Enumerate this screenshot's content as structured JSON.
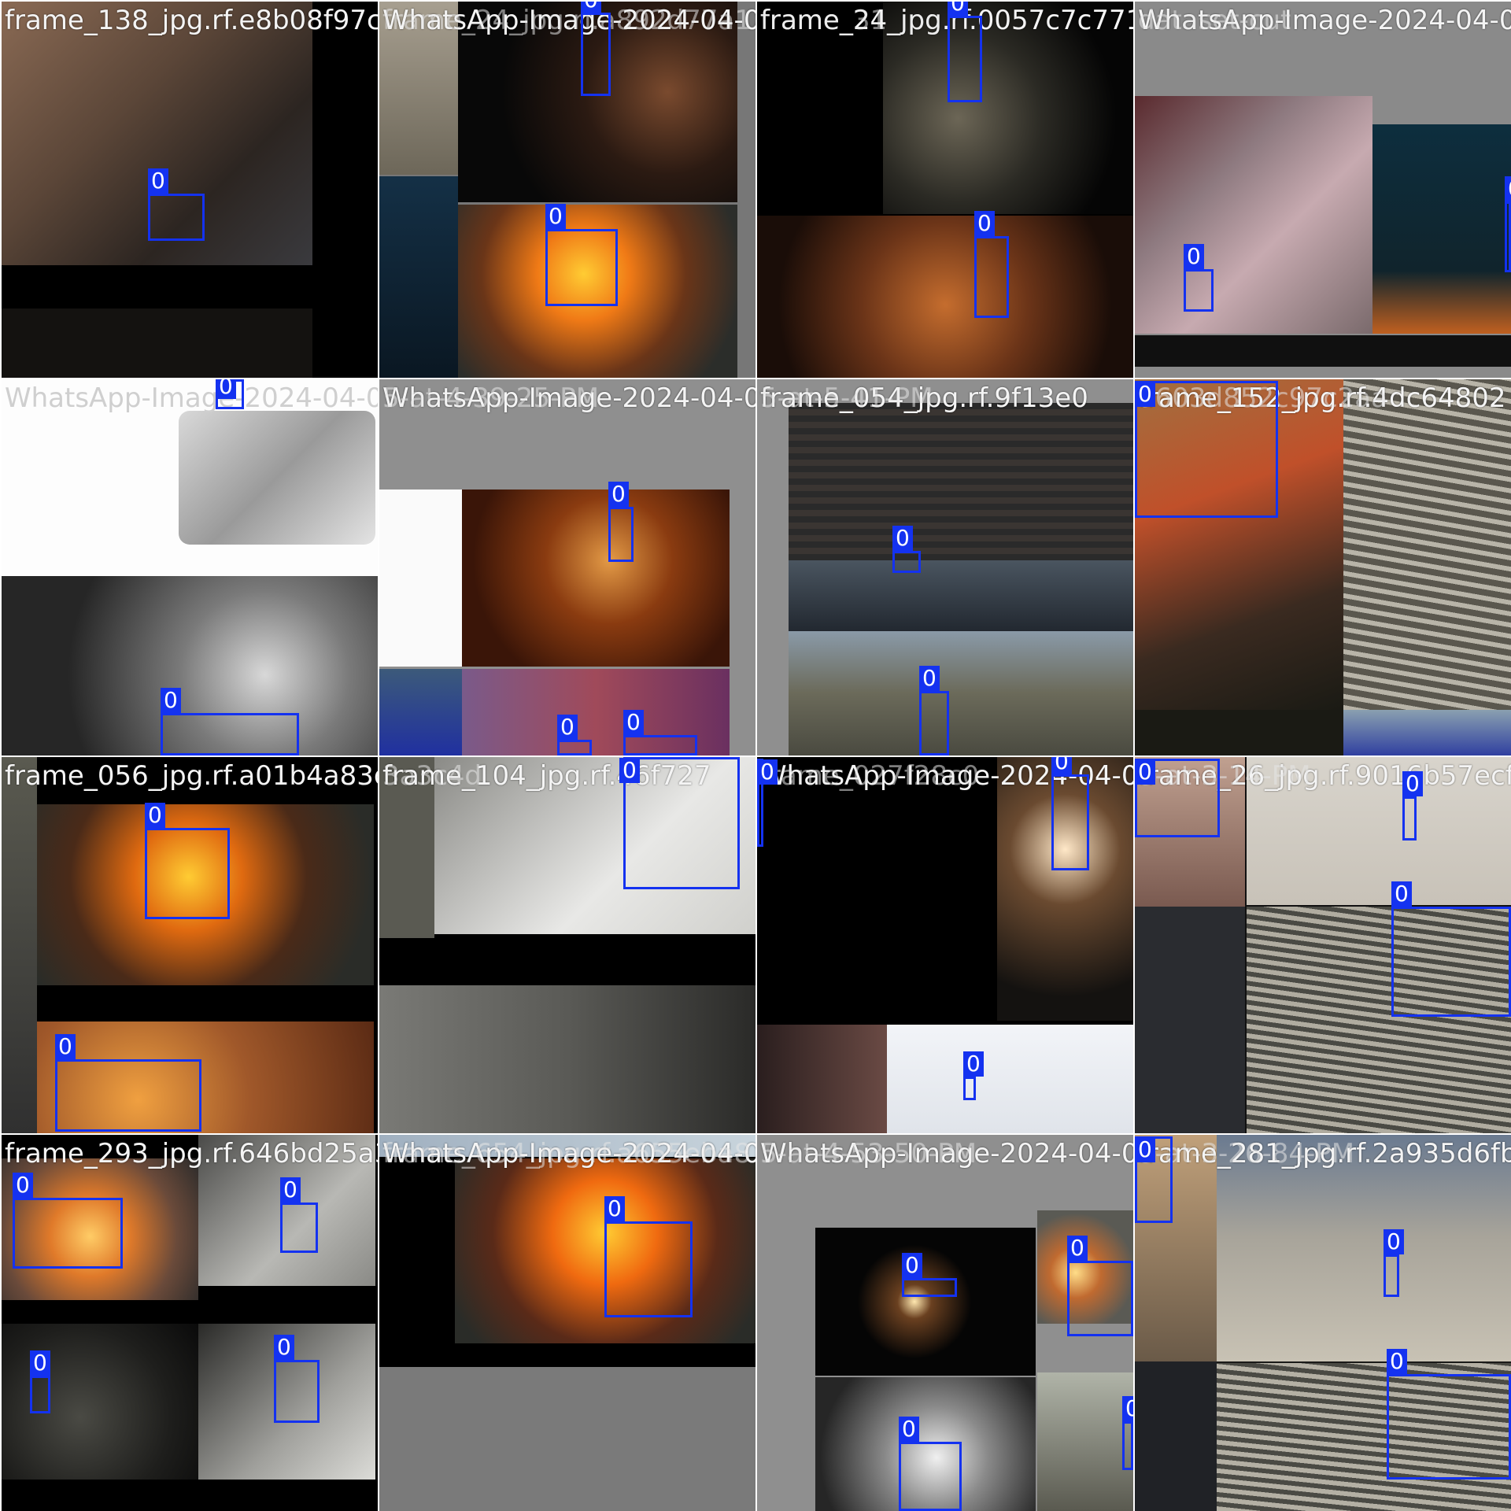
{
  "grid_label": "fire-detection-mosaic",
  "colors": {
    "box": "#1432f0",
    "label_text": "#ffffff",
    "title_text": "#f4f4f4"
  },
  "box_label": "0",
  "tiles": [
    {
      "title": "frame_138_jpg.rf.e8b08f97c",
      "overlay": "",
      "boxes": [
        "0"
      ]
    },
    {
      "title": "WhatsApp-Image-2024-04-0",
      "overlay": "frame_24_jpg.rf.a892d77a1",
      "boxes": [
        "0",
        "0"
      ]
    },
    {
      "title": "frame_24_jpg.rf.0057c7c771",
      "overlay": "frame_31_jpg",
      "boxes": [
        "0",
        "0"
      ]
    },
    {
      "title": "WhatsApp-Image-2024-04-0",
      "overlay": "dataset-cut",
      "boxes": [
        "0",
        "0"
      ]
    },
    {
      "title": "WhatsApp-Image-2024-04-0",
      "overlay": "",
      "boxes": [
        "0",
        "0"
      ]
    },
    {
      "title": "WhatsApp-Image-2024-04-0",
      "overlay": "5-at-4-39-25-PM",
      "boxes": [
        "0",
        "0",
        "0"
      ]
    },
    {
      "title": "frame_054_jpg.rf.9f13e0",
      "overlay": "5-at-5-41-PM",
      "boxes": [
        "0",
        "0"
      ]
    },
    {
      "title": "frame_152_jpg.rf.4dc64802",
      "overlay": "9603d852c97c2aa",
      "boxes": [
        "0"
      ]
    },
    {
      "title": "frame_056_jpg.rf.a01b4a83d",
      "overlay": "",
      "boxes": [
        "0",
        "0"
      ]
    },
    {
      "title": "frame_104_jpg.rf.46f727",
      "overlay": "3a3c4d",
      "boxes": [
        "0"
      ]
    },
    {
      "title": "WhatsApp-Image-2024-04-0",
      "overlay": "frame_027f28c0",
      "boxes": [
        "0",
        "0",
        "0"
      ]
    },
    {
      "title": "frame_26_jpg.rf.9016b57ecf",
      "overlay": "5-at-3-14-PM",
      "boxes": [
        "0",
        "0",
        "0"
      ]
    },
    {
      "title": "frame_293_jpg.rf.646bd25a3",
      "overlay": "",
      "boxes": [
        "0",
        "0",
        "0",
        "0"
      ]
    },
    {
      "title": "WhatsApp-Image-2024-04-0",
      "overlay": "frame_654_jpg.rf.a655eba8",
      "boxes": [
        "0"
      ]
    },
    {
      "title": "WhatsApp-Image-2024-04-0",
      "overlay": "5-at-4-53-50-PM",
      "boxes": [
        "0",
        "0",
        "0",
        "0"
      ]
    },
    {
      "title": "frame_281_jpg.rf.2a935d6fb",
      "overlay": "5-at-3-26-84-PM",
      "boxes": [
        "0",
        "0",
        "0"
      ]
    }
  ]
}
